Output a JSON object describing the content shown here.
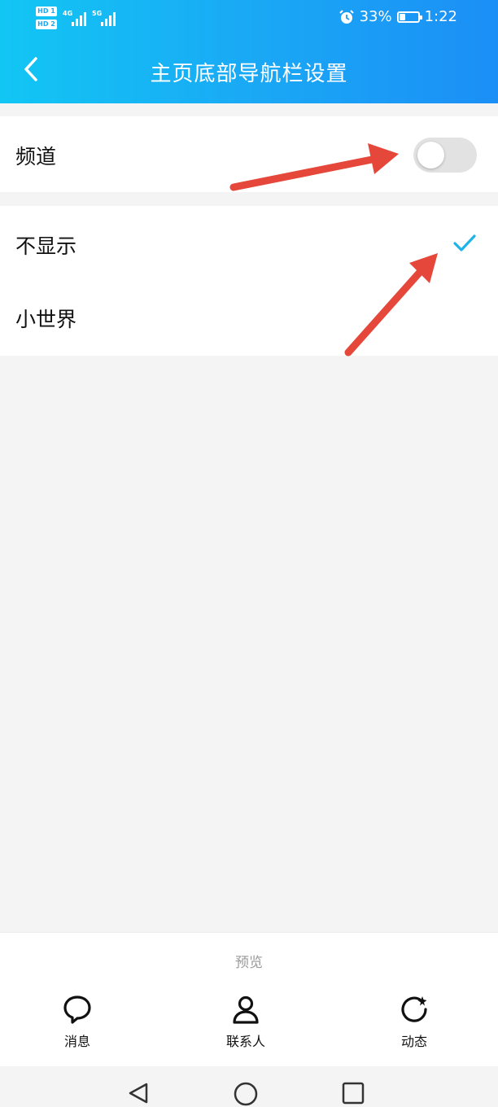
{
  "status_bar": {
    "sim1": "HD 1",
    "sim2": "HD 2",
    "net1": "4G",
    "net2": "5G",
    "battery_percent": "33%",
    "battery_level": 0.33,
    "time": "1:22",
    "icons": [
      "alarm-icon",
      "battery-icon",
      "signal-icon"
    ]
  },
  "header": {
    "title": "主页底部导航栏设置",
    "back_icon": "chevron-left-icon"
  },
  "channel_section": {
    "label": "频道",
    "toggle_on": false
  },
  "options": [
    {
      "label": "不显示",
      "selected": true
    },
    {
      "label": "小世界",
      "selected": false
    }
  ],
  "preview": {
    "title": "预览",
    "tabs": [
      {
        "label": "消息",
        "icon": "message-bubble-icon"
      },
      {
        "label": "联系人",
        "icon": "contact-person-icon"
      },
      {
        "label": "动态",
        "icon": "star-refresh-icon"
      }
    ]
  },
  "colors": {
    "header_gradient_start": "#12c6f4",
    "header_gradient_end": "#1b8ff6",
    "check": "#1fb4e8",
    "annotation_arrow": "#e5473a",
    "toggle_off": "#e2e2e2"
  }
}
